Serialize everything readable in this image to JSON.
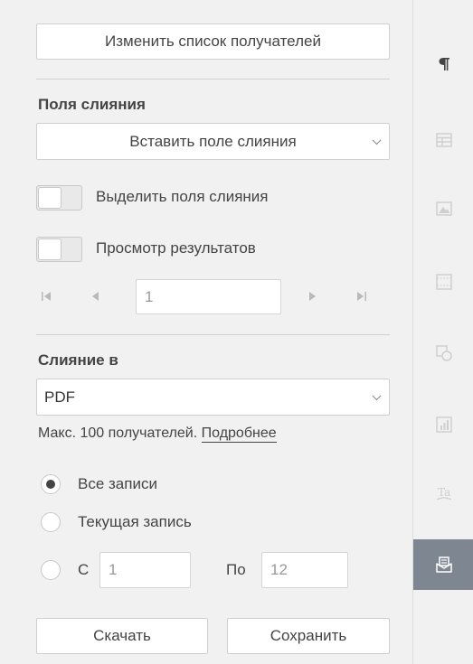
{
  "recipients_button": "Изменить список получателей",
  "merge_fields": {
    "heading": "Поля слияния",
    "insert_select": "Вставить поле слияния",
    "highlight_label": "Выделить поля слияния",
    "preview_label": "Просмотр результатов",
    "record_value": "1"
  },
  "merge_to": {
    "heading": "Слияние в",
    "format": "PDF",
    "limit_text": "Макс. 100 получателей.",
    "more_link": "Подробнее"
  },
  "records": {
    "all": "Все записи",
    "current": "Текущая запись",
    "from_label": "С",
    "from_value": "1",
    "to_label": "По",
    "to_value": "12",
    "selected": "all"
  },
  "actions": {
    "download": "Скачать",
    "save": "Сохранить"
  },
  "sidebar_icons": [
    "paragraph-icon",
    "table-icon",
    "image-icon",
    "header-footer-icon",
    "shape-icon",
    "chart-icon",
    "textart-icon",
    "mail-merge-icon"
  ],
  "colors": {
    "active_tab": "#7e8791",
    "panel_bg": "#f1f1f1",
    "border": "#cfcfcf"
  }
}
